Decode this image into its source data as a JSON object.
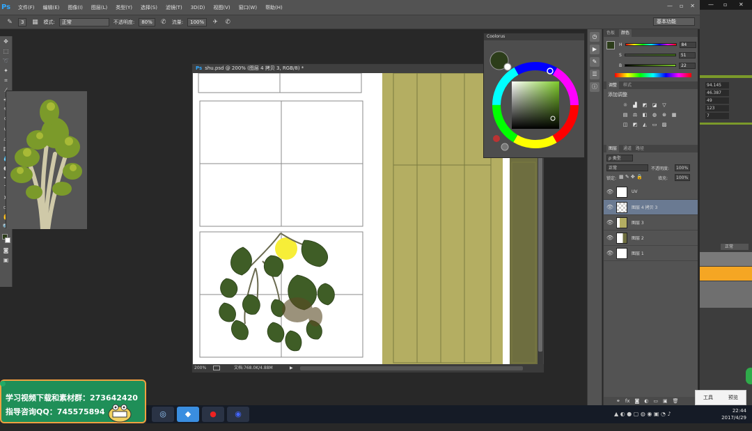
{
  "app": {
    "logo": "Ps"
  },
  "menubar": {
    "items": [
      "文件(F)",
      "编辑(E)",
      "图像(I)",
      "图层(L)",
      "类型(Y)",
      "选择(S)",
      "滤镜(T)",
      "3D(D)",
      "视图(V)",
      "窗口(W)",
      "帮助(H)"
    ]
  },
  "window_controls": {
    "minimize": "—",
    "restore": "▫",
    "close": "✕"
  },
  "options": {
    "brush_size": "3",
    "mode_label": "模式:",
    "mode_value": "正常",
    "opacity_label": "不透明度:",
    "opacity_value": "80%",
    "flow_label": "流量:",
    "flow_value": "100%"
  },
  "workspace": {
    "label": "基本功能"
  },
  "document": {
    "tab_title": "shu.psd @ 200% (图层 4 拷贝 3, RGB/8) *",
    "zoom": "200%",
    "doc_info": "文档:768.0K/4.88M"
  },
  "color_wheel": {
    "title": "Coolorus"
  },
  "color_panel": {
    "tabs": [
      "色板",
      "颜色"
    ],
    "h_label": "H",
    "h_value": "84",
    "s_label": "S",
    "s_value": "51",
    "b_label": "B",
    "b_value": "22"
  },
  "adjustments": {
    "tabs": [
      "调整",
      "样式"
    ],
    "add_label": "添加调整"
  },
  "layers": {
    "tabs": [
      "图层",
      "通道",
      "路径"
    ],
    "filter_label": "ρ 类型",
    "blend_mode": "正常",
    "opacity_label": "不透明度:",
    "opacity_value": "100%",
    "lock_label": "锁定:",
    "fill_label": "填充:",
    "fill_value": "100%",
    "items": [
      {
        "name": "UV"
      },
      {
        "name": "图层 4 拷贝 3"
      },
      {
        "name": "图层 3"
      },
      {
        "name": "图层 2"
      },
      {
        "name": "图层 1"
      }
    ]
  },
  "bg_app": {
    "values": [
      "94.145",
      "46.387",
      "49",
      "123",
      "7"
    ],
    "mode": "正常"
  },
  "mini_dialog": {
    "btn1": "工具",
    "btn2": "预览"
  },
  "clock": {
    "time": "22:44",
    "date": "2017/4/29"
  },
  "promo": {
    "line1": "学习视频下载和素材群：273642420",
    "line2": "指导咨询QQ：745575894"
  },
  "colors": {
    "foreground": "#2c3d1a",
    "accent": "#31a8ff"
  }
}
